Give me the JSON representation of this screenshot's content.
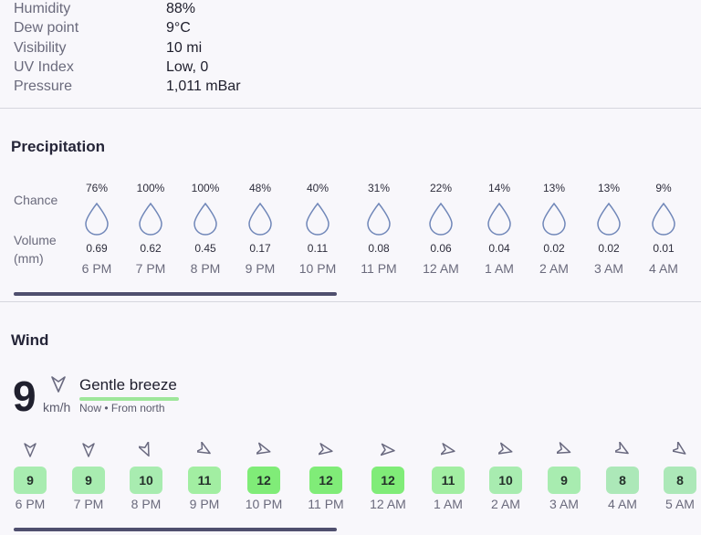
{
  "details": [
    {
      "label": "Humidity",
      "value": "88%"
    },
    {
      "label": "Dew point",
      "value": "9°C"
    },
    {
      "label": "Visibility",
      "value": "10 mi"
    },
    {
      "label": "UV Index",
      "value": "Low, 0"
    },
    {
      "label": "Pressure",
      "value": "1,011 mBar"
    }
  ],
  "precipitation": {
    "title": "Precipitation",
    "chance_label": "Chance",
    "volume_label_line1": "Volume",
    "volume_label_line2": "(mm)",
    "hours": [
      {
        "chance": "76%",
        "volume": "0.69",
        "time": "6 PM"
      },
      {
        "chance": "100%",
        "volume": "0.62",
        "time": "7 PM"
      },
      {
        "chance": "100%",
        "volume": "0.45",
        "time": "8 PM"
      },
      {
        "chance": "48%",
        "volume": "0.17",
        "time": "9 PM"
      },
      {
        "chance": "40%",
        "volume": "0.11",
        "time": "10 PM"
      },
      {
        "chance": "31%",
        "volume": "0.08",
        "time": "11 PM"
      },
      {
        "chance": "22%",
        "volume": "0.06",
        "time": "12 AM"
      },
      {
        "chance": "14%",
        "volume": "0.04",
        "time": "1 AM"
      },
      {
        "chance": "13%",
        "volume": "0.02",
        "time": "2 AM"
      },
      {
        "chance": "13%",
        "volume": "0.02",
        "time": "3 AM"
      },
      {
        "chance": "9%",
        "volume": "0.01",
        "time": "4 AM"
      }
    ]
  },
  "wind": {
    "title": "Wind",
    "speed": "9",
    "unit": "km/h",
    "description": "Gentle breeze",
    "subtitle": "Now • From north",
    "hours": [
      {
        "speed": "9",
        "time": "6 PM",
        "direction_deg": 0,
        "color": "#a8ecb0"
      },
      {
        "speed": "9",
        "time": "7 PM",
        "direction_deg": 0,
        "color": "#a8ecb0"
      },
      {
        "speed": "10",
        "time": "8 PM",
        "direction_deg": 335,
        "color": "#a8ecb0"
      },
      {
        "speed": "11",
        "time": "9 PM",
        "direction_deg": 300,
        "color": "#a2eea2"
      },
      {
        "speed": "12",
        "time": "10 PM",
        "direction_deg": 285,
        "color": "#80ec78"
      },
      {
        "speed": "12",
        "time": "11 PM",
        "direction_deg": 280,
        "color": "#80ec78"
      },
      {
        "speed": "12",
        "time": "12 AM",
        "direction_deg": 275,
        "color": "#80ec78"
      },
      {
        "speed": "11",
        "time": "1 AM",
        "direction_deg": 280,
        "color": "#a2eea2"
      },
      {
        "speed": "10",
        "time": "2 AM",
        "direction_deg": 285,
        "color": "#a8ecb0"
      },
      {
        "speed": "9",
        "time": "3 AM",
        "direction_deg": 290,
        "color": "#a8ecb0"
      },
      {
        "speed": "8",
        "time": "4 AM",
        "direction_deg": 300,
        "color": "#ace8b8"
      },
      {
        "speed": "8",
        "time": "5 AM",
        "direction_deg": 305,
        "color": "#ace8b8"
      }
    ]
  }
}
